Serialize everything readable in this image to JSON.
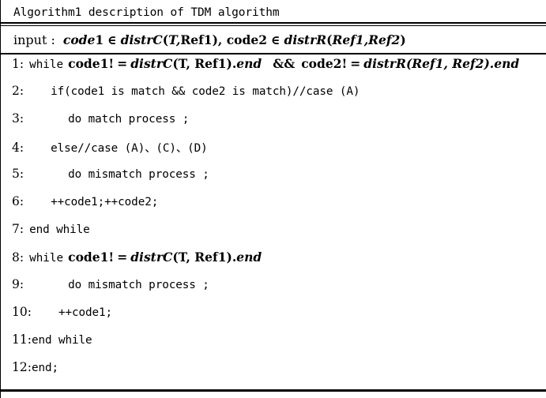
{
  "algorithm": {
    "title": "Algorithm1 description of TDM algorithm",
    "input": {
      "label": "input :",
      "var1": "code",
      "var1_index": "1",
      "in_symbol": "∈",
      "func1_name": "distrC",
      "func1_args_open": "(",
      "func1_arg1": "T",
      "func1_comma": ",",
      "func1_arg2": "Ref",
      "func1_arg2_index": "1",
      "func1_args_close": ")",
      "separator": ", ",
      "var2": "code",
      "var2_index": "2",
      "func2_name": "distrR",
      "func2_arg1": "Ref",
      "func2_arg1_index": "1",
      "func2_arg2": "Ref",
      "func2_arg2_index": "2"
    },
    "lines": [
      {
        "number": "1:",
        "kind": "mixed-while",
        "keyword": "while",
        "var_a": "code1!",
        "eq": "=",
        "func_a": "distrC",
        "func_a_args": "(T, Ref1).",
        "func_a_end": "end",
        "and_op": "&&",
        "var_b": "code2!",
        "func_b": "distrR",
        "func_b_args": "(Ref1, Ref2).",
        "func_b_end": "end"
      },
      {
        "number": "2:",
        "kind": "plain",
        "indent": "lg",
        "text": "if(code1 is match && code2 is match)//case (A)"
      },
      {
        "number": "3:",
        "kind": "plain",
        "indent": "xl",
        "text": "do match process ;"
      },
      {
        "number": "4:",
        "kind": "plain",
        "indent": "lg",
        "text": "else//case (A)、(C)、(D)"
      },
      {
        "number": "5:",
        "kind": "plain",
        "indent": "xl",
        "text": "do mismatch process ;"
      },
      {
        "number": "6:",
        "kind": "plain",
        "indent": "lg",
        "text": "++code1;++code2;"
      },
      {
        "number": "7:",
        "kind": "plain",
        "indent": "sm",
        "text": "end while"
      },
      {
        "number": "8:",
        "kind": "mixed-while8",
        "keyword": "while",
        "var_a": "code1!",
        "eq": "=",
        "func_a": "distrC",
        "func_a_args": "(T, Ref1).",
        "func_a_end": "end"
      },
      {
        "number": "9:",
        "kind": "plain",
        "indent": "xl",
        "text": "do mismatch process ;"
      },
      {
        "number": "10:",
        "kind": "plain",
        "indent": "lg",
        "text": "++code1;"
      },
      {
        "number": "11:",
        "kind": "plain",
        "indent": "none",
        "text": "end while"
      },
      {
        "number": "12:",
        "kind": "plain",
        "indent": "none",
        "text": "end;"
      }
    ]
  }
}
